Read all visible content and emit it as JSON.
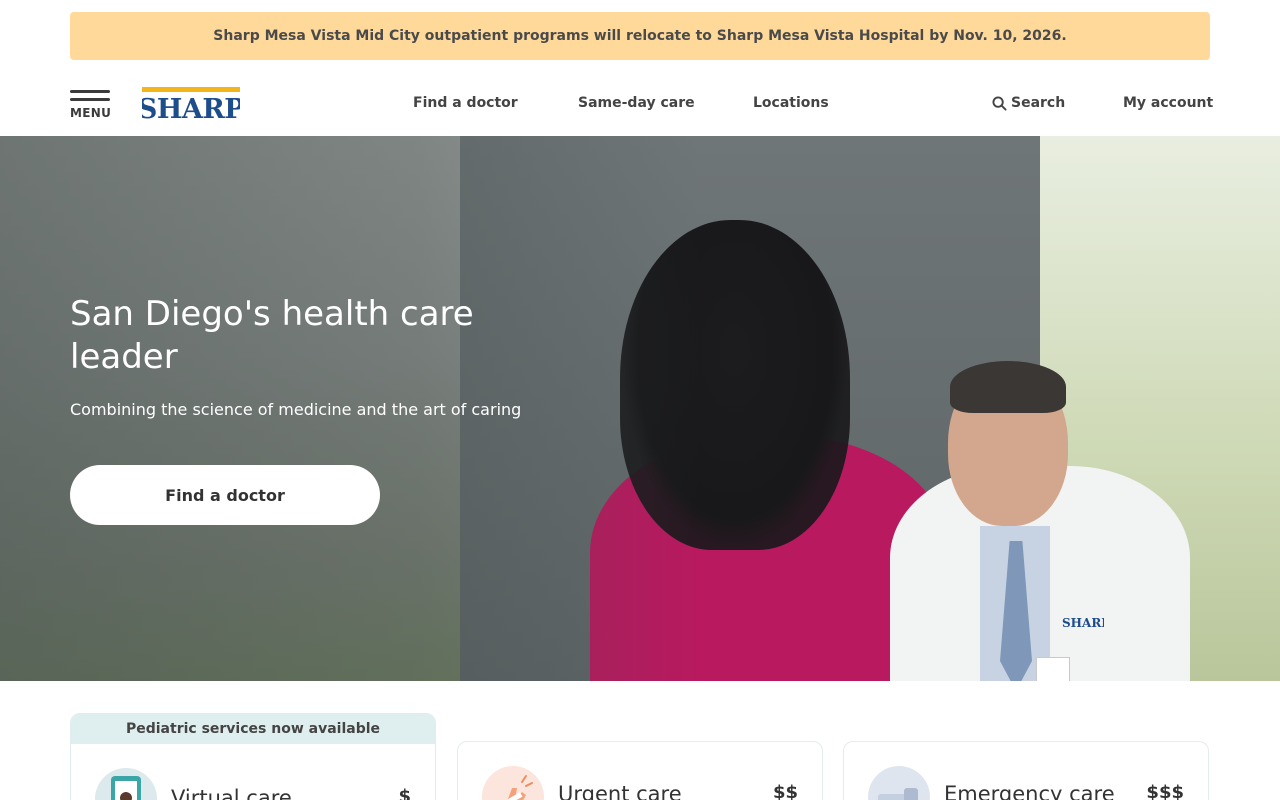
{
  "alert": {
    "text": "Sharp Mesa Vista Mid City outpatient programs will relocate to Sharp Mesa Vista Hospital by Nov. 10, 2026."
  },
  "header": {
    "menu_label": "MENU",
    "logo_text": "SHARP",
    "nav": [
      "Find a doctor",
      "Same-day care",
      "Locations"
    ],
    "search_label": "Search",
    "account_label": "My account"
  },
  "hero": {
    "title": "San Diego's health care leader",
    "subtitle": "Combining the science of medicine and the art of caring",
    "cta_label": "Find a doctor",
    "coat_logo_text": "SHARP"
  },
  "care_cards": [
    {
      "banner": "Pediatric services now available",
      "title": "Virtual care",
      "cost": "$",
      "icon": "tablet-doctor-icon"
    },
    {
      "title": "Urgent care",
      "cost": "$$",
      "icon": "bandaged-hand-icon"
    },
    {
      "title": "Emergency care",
      "cost": "$$$",
      "icon": "ambulance-icon"
    }
  ],
  "colors": {
    "alert_bg": "#ffd99a",
    "brand_blue": "#1e4d8c",
    "brand_yellow": "#f2b51c",
    "scrub_magenta": "#b8195f"
  }
}
